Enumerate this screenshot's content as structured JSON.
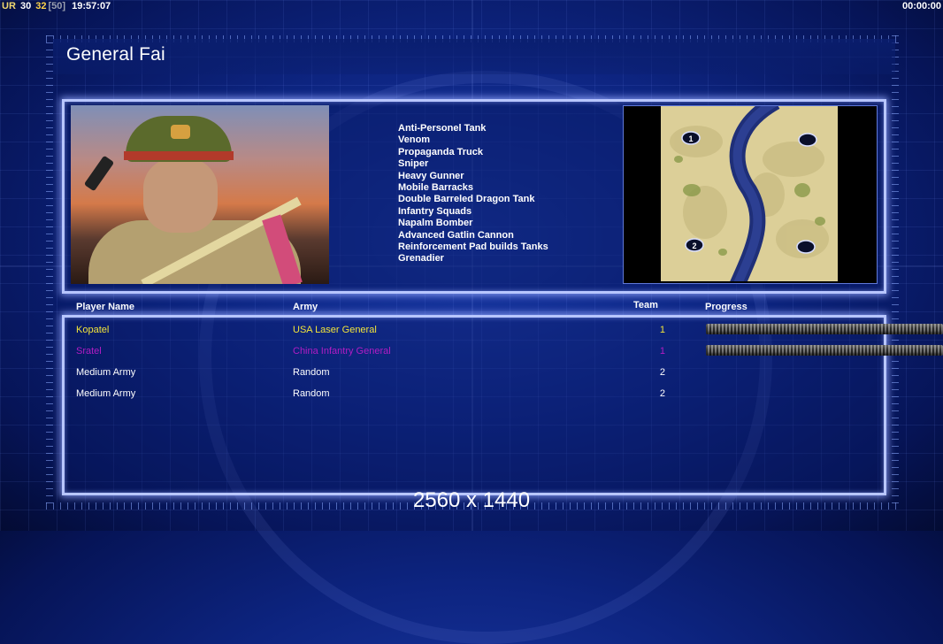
{
  "hud": {
    "tag": "UR",
    "value_a": "30",
    "value_b": "32",
    "bracket": "[50]",
    "clock": "19:57:07",
    "timer": "00:00:00"
  },
  "title": "General Fai",
  "units": [
    "Anti-Personel Tank",
    "Venom",
    "Propaganda Truck",
    "Sniper",
    "Heavy Gunner",
    "Mobile Barracks",
    "Double Barreled Dragon Tank",
    "Infantry Squads",
    "Napalm Bomber",
    "Advanced Gatlin Cannon",
    "Reinforcement Pad builds Tanks",
    "Grenadier"
  ],
  "map": {
    "start_labels": [
      "1",
      "2"
    ]
  },
  "table": {
    "headers": {
      "player": "Player Name",
      "army": "Army",
      "team": "Team",
      "progress": "Progress"
    },
    "rows": [
      {
        "name": "Kopatel",
        "army": "USA Laser General",
        "team": "1",
        "color": "#f2e43a",
        "has_progress": true
      },
      {
        "name": "Sratel",
        "army": "China Infantry General",
        "team": "1",
        "color": "#b21cc4",
        "has_progress": true
      },
      {
        "name": "Medium Army",
        "army": "Random",
        "team": "2",
        "color": "#ffffff",
        "has_progress": false
      },
      {
        "name": "Medium Army",
        "army": "Random",
        "team": "2",
        "color": "#ffffff",
        "has_progress": false
      }
    ]
  },
  "resolution": "2560 x 1440"
}
